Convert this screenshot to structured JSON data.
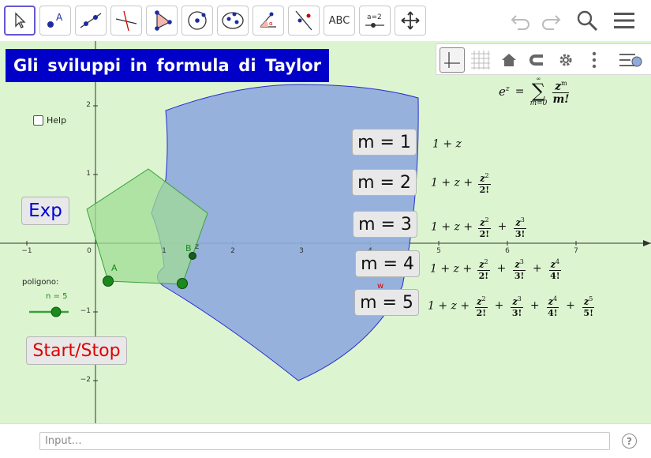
{
  "toolbar": {
    "tools": [
      {
        "name": "move-tool",
        "icon": "cursor-arrow-icon"
      },
      {
        "name": "point-tool",
        "icon": "point-a-icon"
      },
      {
        "name": "line-tool",
        "icon": "line-through-points-icon"
      },
      {
        "name": "perpendicular-line-tool",
        "icon": "perpendicular-icon"
      },
      {
        "name": "polygon-tool",
        "icon": "polygon-icon"
      },
      {
        "name": "circle-tool",
        "icon": "circle-center-point-icon"
      },
      {
        "name": "ellipse-tool",
        "icon": "ellipse-icon"
      },
      {
        "name": "angle-tool",
        "icon": "angle-icon"
      },
      {
        "name": "reflect-tool",
        "icon": "reflect-icon"
      },
      {
        "name": "text-tool",
        "icon": "text-icon",
        "label": "ABC"
      },
      {
        "name": "slider-tool",
        "icon": "slider-icon",
        "label": "a = 2"
      },
      {
        "name": "move-graphics-view-tool",
        "icon": "move-arrows-icon"
      }
    ],
    "actions": [
      "undo-icon",
      "redo-icon",
      "search-icon",
      "menu-icon"
    ]
  },
  "stylebar": {
    "buttons": [
      "axes-icon",
      "grid-icon",
      "home-icon",
      "magnet-icon",
      "gear-icon",
      "more-icon",
      "style-toggle-icon"
    ]
  },
  "title": {
    "words": [
      "Gli",
      "sviluppi",
      "in",
      "formula",
      "di",
      "Taylor"
    ]
  },
  "help_checkbox": {
    "label": "Help",
    "checked": false
  },
  "exp_button": {
    "label": "Exp"
  },
  "start_stop_button": {
    "label": "Start/Stop"
  },
  "slider": {
    "caption": "poligono:",
    "label": "n = 5",
    "value": 5
  },
  "m_buttons": [
    {
      "label": "m = 1"
    },
    {
      "label": "m = 2"
    },
    {
      "label": "m = 3"
    },
    {
      "label": "m = 4"
    },
    {
      "label": "m = 5"
    }
  ],
  "axes": {
    "x_ticks": [
      "−1",
      "0",
      "1",
      "2",
      "3",
      "4",
      "5",
      "6",
      "7"
    ],
    "y_ticks": [
      "2",
      "1",
      "−1",
      "−2"
    ]
  },
  "points": [
    {
      "label": "A",
      "color": "#1a8a1a"
    },
    {
      "label": "B",
      "color": "#1a8a1a"
    },
    {
      "label": "z",
      "color": "#1a5a1a"
    },
    {
      "label": "w",
      "color": "#e00000"
    }
  ],
  "formulas": {
    "series": {
      "lhs": "e",
      "lhs_sup": "z",
      "eq": "=",
      "sum_top": "∞",
      "sum_bottom": "m=0",
      "num": "z",
      "num_sup": "m",
      "den": "m!"
    },
    "m1": "1 + z",
    "m2_prefix": "1 + z +",
    "m3_prefix": "1 + z +",
    "m4_prefix": "1 + z +",
    "m5_prefix": "1 + z +",
    "terms": {
      "t2": {
        "num": "z",
        "sup": "2",
        "den": "2!"
      },
      "t3": {
        "num": "z",
        "sup": "3",
        "den": "3!"
      },
      "t4": {
        "num": "z",
        "sup": "4",
        "den": "4!"
      },
      "t5": {
        "num": "z",
        "sup": "5",
        "den": "5!"
      }
    },
    "plus": "+"
  },
  "input_bar": {
    "placeholder": "Input…"
  },
  "colors": {
    "canvas_bg": "#dcf5d0",
    "title_bg": "#0000c8",
    "blue_region": "#8faadc",
    "blue_region_stroke": "#2a2ad0",
    "pentagon_fill": "#a0dc96",
    "pentagon_stroke": "#3aa03a",
    "exp_text": "#0000d8",
    "start_stop_text": "#e00000"
  }
}
